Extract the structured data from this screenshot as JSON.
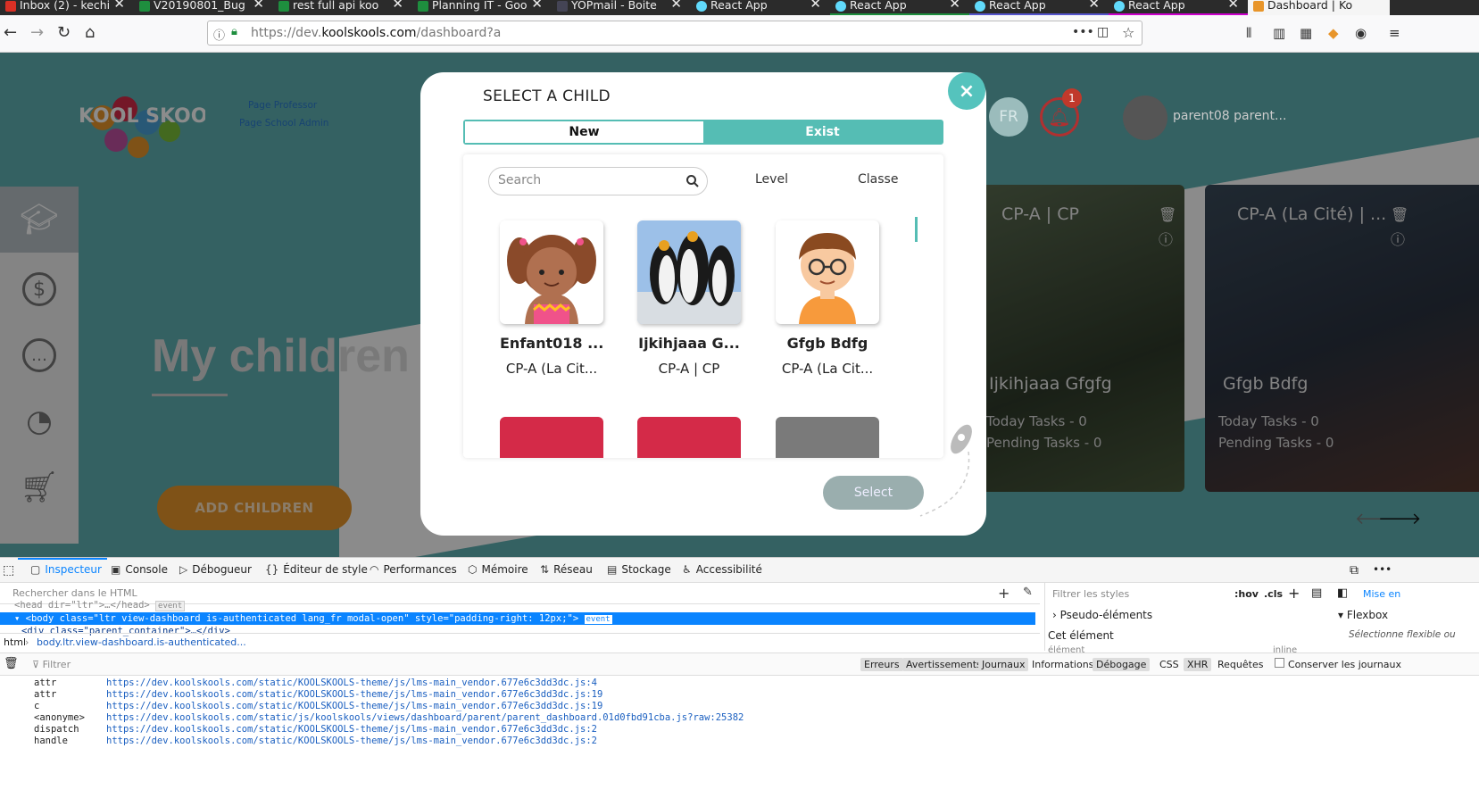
{
  "browser": {
    "tabs": [
      {
        "title": "Inbox (2) - kechi",
        "icon_color": "#d93025"
      },
      {
        "title": "V20190801_Bug",
        "icon_color": "#1e8e3e"
      },
      {
        "title": "rest full api koo",
        "icon_color": "#1e8e3e"
      },
      {
        "title": "Planning IT - Goo",
        "icon_color": "#1e8e3e"
      },
      {
        "title": "YOPmail - Boite",
        "icon_color": "#445"
      },
      {
        "title": "React App",
        "icon_color": "#61dafb"
      },
      {
        "title": "React App",
        "icon_color": "#61dafb"
      },
      {
        "title": "React App",
        "icon_color": "#61dafb"
      },
      {
        "title": "React App",
        "icon_color": "#61dafb"
      },
      {
        "title": "Dashboard | Ko",
        "icon_color": "#e8952a"
      }
    ],
    "url_prefix": "https://dev.",
    "url_domain": "koolskools.com",
    "url_path": "/dashboard?a"
  },
  "app": {
    "logo_text": "KOOL SKOOLS",
    "links": [
      "Page Professor",
      "Page School Admin"
    ],
    "heading": "My children",
    "add_button": "ADD CHILDREN",
    "lang": "FR",
    "notif_count": "1",
    "username": "parent08 parent...",
    "cards": [
      {
        "title": "CP-A | CP",
        "name": "Ijkihjaaa Gfgfg",
        "today": "Today Tasks - 0",
        "pending": "Pending Tasks - 0"
      },
      {
        "title": "CP-A (La Cité) | ...",
        "name": "Gfgb Bdfg",
        "today": "Today Tasks - 0",
        "pending": "Pending Tasks - 0"
      }
    ]
  },
  "modal": {
    "title": "SELECT A CHILD",
    "close": "×",
    "toggle_new": "New",
    "toggle_exist": "Exist",
    "search_placeholder": "Search",
    "filter_level": "Level",
    "filter_classe": "Classe",
    "children": [
      {
        "name": "Enfant018 ...",
        "class": "CP-A (La Cit..."
      },
      {
        "name": "Ijkihjaaa G...",
        "class": "CP-A | CP"
      },
      {
        "name": "Gfgb Bdfg",
        "class": "CP-A (La Cit..."
      }
    ],
    "select_button": "Select",
    "swatch_colors": [
      "#d42a48",
      "#d42a48",
      "#7a7a7a"
    ]
  },
  "devtools": {
    "tabs": [
      "Inspecteur",
      "Console",
      "Débogueur",
      "Éditeur de style",
      "Performances",
      "Mémoire",
      "Réseau",
      "Stockage",
      "Accessibilité"
    ],
    "html_search_placeholder": "Rechercher dans le HTML",
    "line_head": "<head dir=\"ltr\">…</head>",
    "line_body": "<body class=\"ltr view-dashboard is-authenticated lang_fr modal-open\" style=\"padding-right: 12px;\">",
    "line_div": "<div class=\"parent_container\">…</div>",
    "event_badge": "event",
    "breadcrumb_root": "html",
    "breadcrumb_item": "body.ltr.view-dashboard.is-authenticated...",
    "styles_filter": "Filtrer les styles",
    "hov": ":hov",
    "cls": ".cls",
    "mise_en": "Mise en",
    "pseudo": "Pseudo-éléments",
    "cet_element": "Cet élément",
    "element_label": "élément",
    "inline_label": "inline",
    "flexbox": "Flexbox",
    "flexbox_note": "Sélectionne flexible ou",
    "console_filter": "Filtrer",
    "console_levels": [
      "Erreurs",
      "Avertissements",
      "Journaux",
      "Informations",
      "Débogage",
      "CSS",
      "XHR",
      "Requêtes"
    ],
    "persist": "Conserver les journaux",
    "logs": [
      {
        "fn": "attr",
        "url": "https://dev.koolskools.com/static/KOOLSKOOLS-theme/js/lms-main_vendor.677e6c3dd3dc.js:4"
      },
      {
        "fn": "attr",
        "url": "https://dev.koolskools.com/static/KOOLSKOOLS-theme/js/lms-main_vendor.677e6c3dd3dc.js:19"
      },
      {
        "fn": "c",
        "url": "https://dev.koolskools.com/static/KOOLSKOOLS-theme/js/lms-main_vendor.677e6c3dd3dc.js:19"
      },
      {
        "fn": "<anonyme>",
        "url": "https://dev.koolskools.com/static/js/koolskools/views/dashboard/parent/parent_dashboard.01d0fbd91cba.js?raw:25382"
      },
      {
        "fn": "dispatch",
        "url": "https://dev.koolskools.com/static/KOOLSKOOLS-theme/js/lms-main_vendor.677e6c3dd3dc.js:2"
      },
      {
        "fn": "handle",
        "url": "https://dev.koolskools.com/static/KOOLSKOOLS-theme/js/lms-main_vendor.677e6c3dd3dc.js:2"
      }
    ]
  }
}
